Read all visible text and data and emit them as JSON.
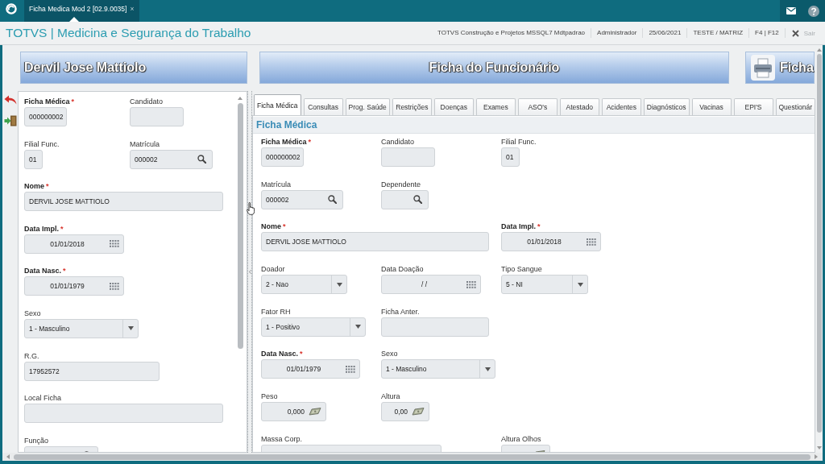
{
  "app_bar": {
    "tabs": [
      {
        "title": "Ficha Medica Mod 2 [02.9.0035]",
        "close": "×",
        "selected": true
      }
    ]
  },
  "header": {
    "title": "TOTVS | Medicina e Segurança do Trabalho",
    "info": [
      "TOTVS Construção e Projetos MSSQL7 Mdtpadrao",
      "Administrador",
      "25/06/2021",
      "TESTE / MATRIZ",
      "F4 | F12"
    ],
    "exit": {
      "label": "Sair",
      "disabled": true
    }
  },
  "left_panel": {
    "banner": "Dervil Jose Mattiolo",
    "rows": [
      [
        {
          "label": "Ficha Médica",
          "required": true,
          "required_mark": "*",
          "kind": "text",
          "value": "000000002"
        },
        {
          "label": "Candidato",
          "required": false,
          "kind": "text"
        }
      ],
      [
        {
          "label": "Filial Func.",
          "required": false,
          "kind": "text",
          "value": "01"
        },
        {
          "label": "Matrícula",
          "required": false,
          "kind": "lookup",
          "value": "000002"
        }
      ],
      [
        {
          "label": "Nome",
          "required": true,
          "required_mark": "*",
          "kind": "text",
          "value": "DERVIL JOSE MATTIOLO"
        }
      ],
      [
        {
          "label": "Data Impl.",
          "required": true,
          "required_mark": "*",
          "kind": "date",
          "value": "01/01/2018"
        }
      ],
      [
        {
          "label": "Data Nasc.",
          "required": true,
          "required_mark": "*",
          "kind": "date",
          "value": "01/01/1979"
        }
      ],
      [
        {
          "label": "Sexo",
          "required": false,
          "kind": "select",
          "value": "1 - Masculino"
        }
      ],
      [
        {
          "label": "R.G.",
          "required": false,
          "kind": "text",
          "value": "17952572"
        }
      ],
      [
        {
          "label": "Local Ficha",
          "required": false,
          "kind": "text"
        }
      ],
      [
        {
          "label": "Função",
          "required": false,
          "kind": "lookup"
        }
      ]
    ]
  },
  "right_panel": {
    "banner": "Ficha do Funcionário",
    "print_button": "Ficha",
    "tabs": [
      {
        "label": "Ficha Médica",
        "selected": true
      },
      {
        "label": "Consultas",
        "selected": false
      },
      {
        "label": "Prog. Saúde",
        "selected": false
      },
      {
        "label": "Restrições",
        "selected": false
      },
      {
        "label": "Doenças",
        "selected": false
      },
      {
        "label": "Exames",
        "selected": false
      },
      {
        "label": "ASO's",
        "selected": false
      },
      {
        "label": "Atestado",
        "selected": false
      },
      {
        "label": "Acidentes",
        "selected": false
      },
      {
        "label": "Diagnósticos",
        "selected": false
      },
      {
        "label": "Vacinas",
        "selected": false
      },
      {
        "label": "EPI'S",
        "selected": false
      },
      {
        "label": "Questionár",
        "selected": false
      }
    ],
    "section_title": "Ficha Médica",
    "rows": [
      [
        {
          "label": "Ficha Médica",
          "required": true,
          "required_mark": "*",
          "kind": "text",
          "value": "000000002"
        },
        {
          "label": "Candidato",
          "required": false,
          "kind": "text"
        },
        {
          "label": "Filial Func.",
          "required": false,
          "kind": "text",
          "value": "01"
        }
      ],
      [
        {
          "label": "Matrícula",
          "required": false,
          "kind": "lookup",
          "value": "000002"
        },
        {
          "label": "Dependente",
          "required": false,
          "kind": "lookup"
        }
      ],
      [
        {
          "label": "Nome",
          "required": true,
          "required_mark": "*",
          "kind": "text",
          "value": "DERVIL JOSE MATTIOLO"
        },
        {
          "label": "Data Impl.",
          "required": true,
          "required_mark": "*",
          "kind": "date",
          "value": "01/01/2018"
        }
      ],
      [
        {
          "label": "Doador",
          "required": false,
          "kind": "select",
          "value": "2 - Nao"
        },
        {
          "label": "Data Doação",
          "required": false,
          "kind": "date",
          "value": "/ /"
        },
        {
          "label": "Tipo Sangue",
          "required": false,
          "kind": "select",
          "value": "5 - NI"
        }
      ],
      [
        {
          "label": "Fator RH",
          "required": false,
          "kind": "select",
          "value": "1 - Positivo"
        },
        {
          "label": "Ficha Anter.",
          "required": false,
          "kind": "text"
        }
      ],
      [
        {
          "label": "Data Nasc.",
          "required": true,
          "required_mark": "*",
          "kind": "date",
          "value": "01/01/1979"
        },
        {
          "label": "Sexo",
          "required": false,
          "kind": "select",
          "value": "1 - Masculino"
        }
      ],
      [
        {
          "label": "Peso",
          "required": false,
          "kind": "number",
          "value": "0,000"
        },
        {
          "label": "Altura",
          "required": false,
          "kind": "number",
          "value": "0,00"
        }
      ],
      [
        {
          "label": "Massa Corp.",
          "required": false,
          "kind": "text"
        },
        {
          "label": "Altura Olhos",
          "required": false,
          "kind": "number"
        }
      ]
    ]
  }
}
